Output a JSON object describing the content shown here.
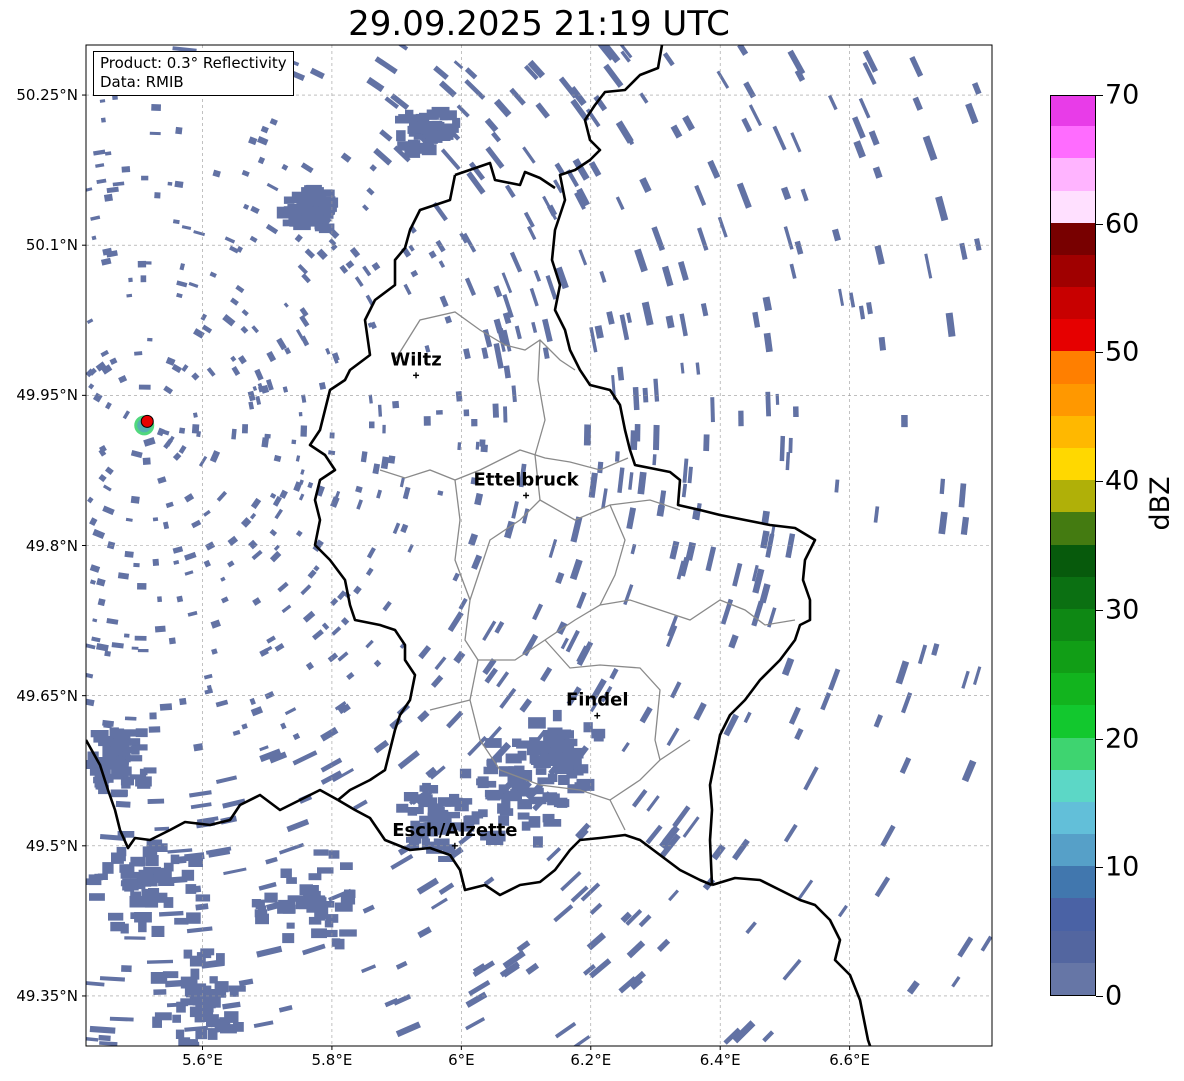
{
  "title": "29.09.2025 21:19 UTC",
  "info": {
    "product": "Product: 0.3° Reflectivity",
    "data": "Data: RMIB"
  },
  "map": {
    "lon_range": [
      5.42,
      6.82
    ],
    "lat_range": [
      49.3,
      50.3
    ],
    "lat_ticks": [
      {
        "value": 50.25,
        "label": "50.25°N"
      },
      {
        "value": 50.1,
        "label": "50.1°N"
      },
      {
        "value": 49.95,
        "label": "49.95°N"
      },
      {
        "value": 49.8,
        "label": "49.8°N"
      },
      {
        "value": 49.65,
        "label": "49.65°N"
      },
      {
        "value": 49.5,
        "label": "49.5°N"
      },
      {
        "value": 49.35,
        "label": "49.35°N"
      }
    ],
    "lon_ticks": [
      {
        "value": 5.6,
        "label": "5.6°E"
      },
      {
        "value": 5.8,
        "label": "5.8°E"
      },
      {
        "value": 6.0,
        "label": "6°E"
      },
      {
        "value": 6.2,
        "label": "6.2°E"
      },
      {
        "value": 6.4,
        "label": "6.4°E"
      },
      {
        "value": 6.6,
        "label": "6.6°E"
      }
    ],
    "gridlines": true,
    "cities": [
      {
        "name": "Wiltz",
        "lon": 5.93,
        "lat": 49.97
      },
      {
        "name": "Ettelbruck",
        "lon": 6.1,
        "lat": 49.85
      },
      {
        "name": "Findel",
        "lon": 6.21,
        "lat": 49.63
      },
      {
        "name": "Esch/Alzette",
        "lon": 5.99,
        "lat": 49.5
      }
    ],
    "radar_site": {
      "lon": 5.51,
      "lat": 49.92
    },
    "echo_color": "#6272a4",
    "border_color": "#000000",
    "canton_color": "#8a8a8a"
  },
  "colorbar": {
    "unit": "dBZ",
    "min": 0,
    "max": 70,
    "ticks": [
      {
        "value": 0,
        "label": "0"
      },
      {
        "value": 10,
        "label": "10"
      },
      {
        "value": 20,
        "label": "20"
      },
      {
        "value": 30,
        "label": "30"
      },
      {
        "value": 40,
        "label": "40"
      },
      {
        "value": 50,
        "label": "50"
      },
      {
        "value": 60,
        "label": "60"
      },
      {
        "value": 70,
        "label": "70"
      }
    ],
    "colors": [
      "#6676a6",
      "#5366a0",
      "#4a62a5",
      "#4177ae",
      "#56a0c8",
      "#62bfd9",
      "#5cd7c6",
      "#3ed470",
      "#12c82e",
      "#12b41e",
      "#119e16",
      "#0e8814",
      "#0b7012",
      "#075a0c",
      "#447b11",
      "#b0b008",
      "#ffd800",
      "#ffb800",
      "#ff9800",
      "#ff7f00",
      "#e60000",
      "#c80000",
      "#a00000",
      "#780000",
      "#ffe0ff",
      "#ffb4ff",
      "#ff6cff",
      "#e83ce8"
    ]
  }
}
